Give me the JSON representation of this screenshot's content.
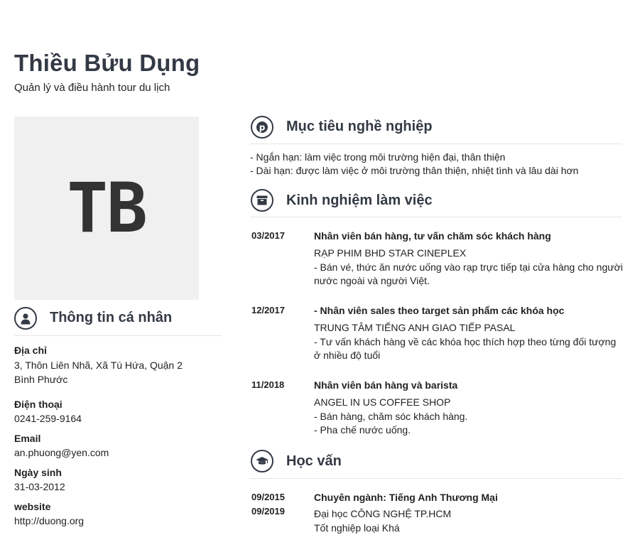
{
  "header": {
    "name": "Thiều Bửu Dụng",
    "job_title": "Quản lý và điều hành tour du lịch"
  },
  "avatar": {
    "initials": "TB"
  },
  "personal": {
    "section_title": "Thông tin cá nhân",
    "address": {
      "label": "Địa chỉ",
      "line1": "3, Thôn Liên Nhã, Xã Tú Hứa, Quận 2",
      "line2": "Bình Phước"
    },
    "phone": {
      "label": "Điện thoại",
      "value": "0241-259-9164"
    },
    "email": {
      "label": "Email",
      "value": "an.phuong@yen.com"
    },
    "birthday": {
      "label": "Ngày sinh",
      "value": "31-03-2012"
    },
    "website": {
      "label": "website",
      "value": "http://duong.org"
    }
  },
  "objective": {
    "section_title": "Mục tiêu nghề nghiệp",
    "lines": [
      "- Ngắn hạn: làm việc trong môi trường hiện đại, thân thiện",
      "- Dài hạn: được làm việc ở môi trường thân thiện, nhiệt tình và lâu dài hơn"
    ]
  },
  "experience": {
    "section_title": "Kinh nghiệm làm việc",
    "items": [
      {
        "date": "03/2017",
        "title": "Nhân viên bán hàng, tư vấn chăm sóc khách hàng",
        "company": "RẠP PHIM BHD STAR CINEPLEX",
        "desc": [
          "- Bán vé, thức ăn nước uống vào rạp trực tiếp tại cửa hàng cho người",
          "nước ngoài và người Việt."
        ]
      },
      {
        "date": "12/2017",
        "title": "- Nhân viên sales theo target sản phẩm các khóa học",
        "company": "TRUNG TÂM TIẾNG ANH GIAO TIẾP PASAL",
        "desc": [
          "- Tư vấn khách hàng về các khóa học thích hợp theo từng đối tượng",
          "ở nhiều độ tuổi"
        ]
      },
      {
        "date": "11/2018",
        "title": "Nhân viên bán hàng và barista",
        "company": "ANGEL IN US COFFEE SHOP",
        "desc": [
          "- Bán hàng, chăm sóc khách hàng.",
          "- Pha chế nước uống."
        ]
      }
    ]
  },
  "education": {
    "section_title": "Học vấn",
    "items": [
      {
        "date_start": "09/2015",
        "date_end": "09/2019",
        "title": "Chuyên ngành: Tiếng Anh Thương Mại",
        "school": "Đại học CÔNG NGHỆ TP.HCM",
        "note": "Tốt nghiệp loại Khá"
      }
    ]
  }
}
